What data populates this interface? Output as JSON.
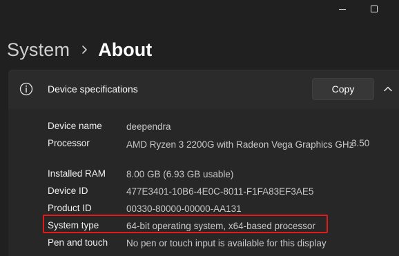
{
  "window": {
    "controls": [
      "minimize-icon",
      "maximize-icon"
    ]
  },
  "breadcrumb": {
    "parent": "System",
    "separator_icon": "chevron-right-icon",
    "current": "About"
  },
  "device_specs": {
    "header": {
      "icon": "info-icon",
      "title": "Device specifications",
      "copy_label": "Copy",
      "collapse_icon": "chevron-up-icon"
    },
    "rows": [
      {
        "label": "Device name",
        "value": "deependra"
      },
      {
        "label": "Processor",
        "value": "AMD Ryzen 3 2200G with Radeon Vega Graphics GHz",
        "extra": "3.50"
      },
      {
        "label": "Installed RAM",
        "value": "8.00 GB (6.93 GB usable)"
      },
      {
        "label": "Device ID",
        "value": "477E3401-10B6-4E0C-8011-F1FA83EF3AE5"
      },
      {
        "label": "Product ID",
        "value": "00330-80000-00000-AA131"
      },
      {
        "label": "System type",
        "value": "64-bit operating system, x64-based processor"
      },
      {
        "label": "Pen and touch",
        "value": "No pen or touch input is available for this display"
      }
    ],
    "highlight_color": "#e01b1b"
  }
}
